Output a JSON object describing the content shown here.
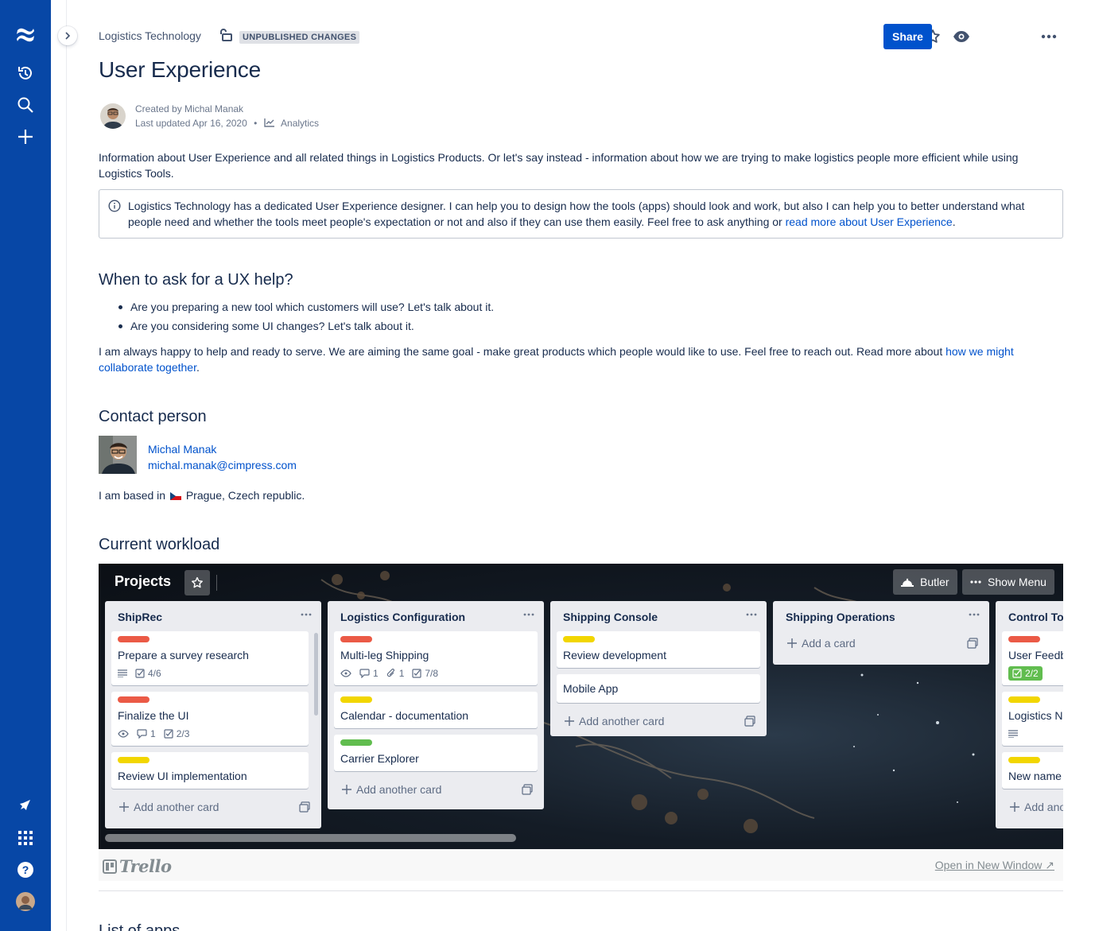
{
  "nav": {
    "icons": [
      "confluence-logo-icon",
      "recent-icon",
      "search-icon",
      "create-icon",
      "feedback-icon",
      "app-switcher-icon",
      "help-icon",
      "profile-avatar"
    ]
  },
  "breadcrumb": "Logistics Technology",
  "status_badge": "UNPUBLISHED CHANGES",
  "toolbar": {
    "share_label": "Share"
  },
  "page": {
    "title": "User Experience",
    "created_by": "Created by Michal Manak",
    "last_updated": "Last updated Apr 16, 2020",
    "analytics": "Analytics"
  },
  "intro": "Information about User Experience and all related things in Logistics Products. Or let's say instead - information about how we are trying to make logistics people more efficient while using Logistics Tools.",
  "info_panel": {
    "text": "Logistics Technology has a dedicated User Experience designer. I can help you to design how the tools (apps) should look and work, but also I can help you to better understand what people need and whether the tools meet people's expectation or not and also if they can use them easily. Feel free to ask anything or ",
    "link": "read more about User Experience",
    "end": "."
  },
  "section_ux": {
    "heading": "When to ask for a UX help?",
    "bullets": [
      "Are you preparing a new tool which customers will use? Let's talk about it.",
      "Are you considering some UI changes? Let's talk about it."
    ],
    "paragraph": "I am always happy to help and ready to serve. We are aiming the same goal - make great products which people would like to use. Feel free to reach out. Read more about ",
    "link": "how we might collaborate together",
    "end": "."
  },
  "contact": {
    "heading": "Contact person",
    "name": "Michal Manak",
    "email": "michal.manak@cimpress.com",
    "based_prefix": "I am based in",
    "based_location": "Prague, Czech republic."
  },
  "workload": {
    "heading": "Current workload",
    "board_title": "Projects",
    "butler_label": "Butler",
    "menu_label": "Show Menu",
    "add_another": "Add another card",
    "add_card": "Add a card",
    "lists": [
      {
        "name": "ShipRec",
        "cards": [
          {
            "title": "Prepare a survey research",
            "label": "#eb5a46",
            "checklist": "4/6"
          },
          {
            "title": "Finalize the UI",
            "label": "#eb5a46",
            "comments": "1",
            "checklist": "2/3"
          },
          {
            "title": "Review UI implementation",
            "label": "#f2d600"
          }
        ]
      },
      {
        "name": "Logistics Configuration",
        "cards": [
          {
            "title": "Multi-leg Shipping",
            "label": "#eb5a46",
            "comments": "1",
            "attachments": "1",
            "checklist": "7/8"
          },
          {
            "title": "Calendar - documentation",
            "label": "#f2d600"
          },
          {
            "title": "Carrier Explorer",
            "label": "#61bd4f"
          }
        ]
      },
      {
        "name": "Shipping Console",
        "cards": [
          {
            "title": "Review development",
            "label": "#f2d600"
          },
          {
            "title": "Mobile App"
          }
        ]
      },
      {
        "name": "Shipping Operations",
        "cards": []
      },
      {
        "name": "Control Tower",
        "cards": [
          {
            "title": "User Feedback",
            "label": "#eb5a46",
            "checklist": "2/2"
          },
          {
            "title": "Logistics Network",
            "label": "#f2d600"
          },
          {
            "title": "New name",
            "label": "#f2d600"
          }
        ]
      }
    ],
    "footer_logo": "Trello",
    "open_new_window": "Open in New Window ↗"
  },
  "next_heading": "List of apps"
}
